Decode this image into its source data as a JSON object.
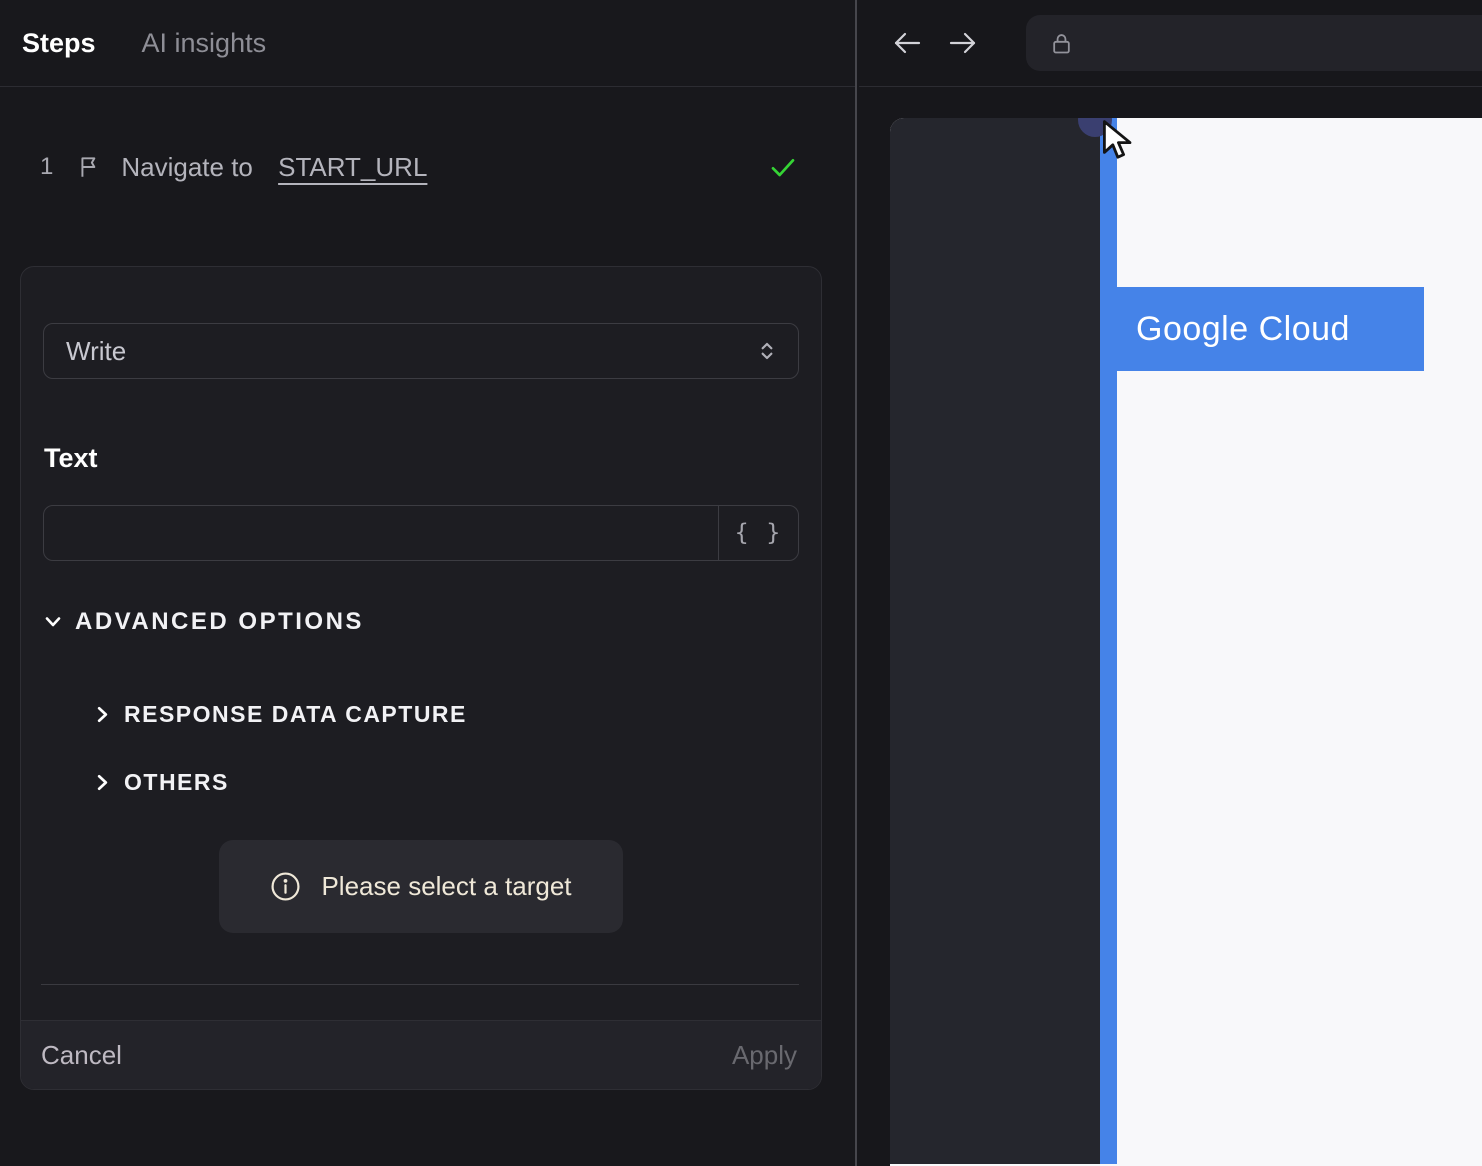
{
  "left_panel": {
    "tabs": [
      {
        "label": "Steps"
      },
      {
        "label": "AI insights"
      }
    ],
    "step": {
      "number": "1",
      "text": "Navigate to ",
      "link": "START_URL"
    },
    "editor": {
      "action_value": "Write",
      "text_label": "Text",
      "text_input_value": "",
      "variables_button": "{ }",
      "advanced_label": "ADVANCED OPTIONS",
      "sections": [
        {
          "label": "RESPONSE DATA CAPTURE"
        },
        {
          "label": "OTHERS"
        }
      ],
      "hint": "Please select a target",
      "cancel": "Cancel",
      "apply": "Apply"
    }
  },
  "browser": {
    "page_banner": "Google Cloud"
  },
  "colors": {
    "accent_blue": "#4583e8",
    "success_green": "#35d435",
    "hint_cream": "#efe8d8",
    "circle_indigo": "#3a3f70"
  }
}
